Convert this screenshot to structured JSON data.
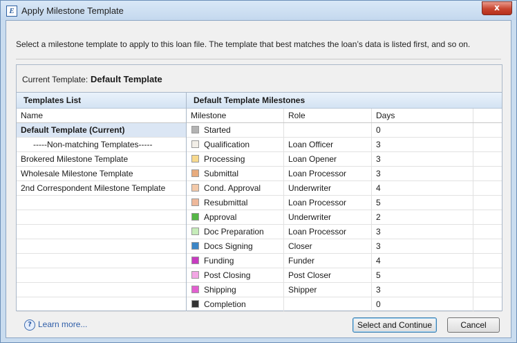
{
  "window": {
    "title": "Apply Milestone Template",
    "app_icon_letter": "E",
    "close_glyph": "x"
  },
  "intro_text": "Select a milestone template to apply to this loan file. The template that best matches the loan’s data is listed first, and so on.",
  "current_template": {
    "label": "Current Template:",
    "value": "Default Template"
  },
  "templates_list": {
    "header": "Templates List",
    "column_header": "Name",
    "items": [
      {
        "label": "Default Template (Current)",
        "selected": true
      },
      {
        "label": "-----Non-matching Templates-----"
      },
      {
        "label": "Brokered Milestone Template"
      },
      {
        "label": "Wholesale Milestone Template"
      },
      {
        "label": "2nd Correspondent Milestone Template"
      }
    ]
  },
  "milestones_panel": {
    "header": "Default Template Milestones",
    "columns": [
      "Milestone",
      "Role",
      "Days"
    ],
    "rows": [
      {
        "name": "Started",
        "role": "",
        "days": "0",
        "color": "#b3b3b3"
      },
      {
        "name": "Qualification",
        "role": "Loan Officer",
        "days": "3",
        "color": "#f2eee7"
      },
      {
        "name": "Processing",
        "role": "Loan Opener",
        "days": "3",
        "color": "#f7d98d"
      },
      {
        "name": "Submittal",
        "role": "Loan Processor",
        "days": "3",
        "color": "#e8ac7e"
      },
      {
        "name": "Cond. Approval",
        "role": "Underwriter",
        "days": "4",
        "color": "#f3c9a9"
      },
      {
        "name": "Resubmittal",
        "role": "Loan Processor",
        "days": "5",
        "color": "#eeb89a"
      },
      {
        "name": "Approval",
        "role": "Underwriter",
        "days": "2",
        "color": "#55b646"
      },
      {
        "name": "Doc Preparation",
        "role": "Loan Processor",
        "days": "3",
        "color": "#c6ecb9"
      },
      {
        "name": "Docs Signing",
        "role": "Closer",
        "days": "3",
        "color": "#3c86c6"
      },
      {
        "name": "Funding",
        "role": "Funder",
        "days": "4",
        "color": "#c73bc0"
      },
      {
        "name": "Post Closing",
        "role": "Post Closer",
        "days": "5",
        "color": "#f2a6e4"
      },
      {
        "name": "Shipping",
        "role": "Shipper",
        "days": "3",
        "color": "#e25fd0"
      },
      {
        "name": "Completion",
        "role": "",
        "days": "0",
        "color": "#333333"
      }
    ]
  },
  "footer": {
    "help_glyph": "?",
    "learn_more": "Learn more...",
    "primary_button": "Select and Continue",
    "cancel_button": "Cancel"
  }
}
